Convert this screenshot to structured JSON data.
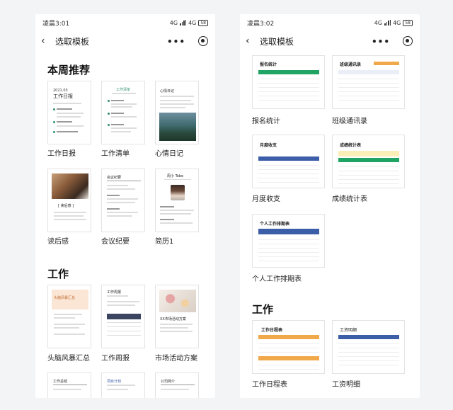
{
  "left_screen": {
    "status": {
      "time": "凌晨3:01",
      "net1": "4G",
      "net2": "4G",
      "battery": "58"
    },
    "nav": {
      "back_glyph": "‹",
      "title": "选取模板",
      "more_glyph": "•••"
    },
    "sections": [
      {
        "title": "本周推荐",
        "templates": [
          {
            "label": "工作日报",
            "thumb_title": "工作日报"
          },
          {
            "label": "工作清单",
            "thumb_title": "工作清单"
          },
          {
            "label": "心情日记",
            "thumb_title": "心情日记"
          },
          {
            "label": "读后感",
            "thumb_title": "[ 读后感 ]"
          },
          {
            "label": "会议纪要",
            "thumb_title": "会议纪要"
          },
          {
            "label": "简历1",
            "thumb_title": "周小 Tobe"
          }
        ]
      },
      {
        "title": "工作",
        "templates": [
          {
            "label": "头脑风暴汇总",
            "thumb_title": "头脑风暴汇总"
          },
          {
            "label": "工作周报",
            "thumb_title": "工作周报"
          },
          {
            "label": "市场活动方案",
            "thumb_title": "XX市场活动方案"
          },
          {
            "label": "",
            "thumb_title": "工作总结"
          },
          {
            "label": "",
            "thumb_title": "项目计划"
          },
          {
            "label": "",
            "thumb_title": "公司简介"
          }
        ]
      }
    ]
  },
  "right_screen": {
    "status": {
      "time": "凌晨3:02",
      "net1": "4G",
      "net2": "4G",
      "battery": "58"
    },
    "nav": {
      "back_glyph": "‹",
      "title": "选取模板",
      "more_glyph": "•••"
    },
    "sections": [
      {
        "title": "",
        "templates": [
          {
            "label": "报名统计",
            "thumb_title": "报名统计"
          },
          {
            "label": "班级通讯录",
            "thumb_title": "班级通讯录"
          },
          {
            "label": "月度收支",
            "thumb_title": "月度收支"
          },
          {
            "label": "成绩统计表",
            "thumb_title": "成绩统计表"
          },
          {
            "label": "个人工作排期表",
            "thumb_title": "个人工作排期表"
          }
        ]
      },
      {
        "title": "工作",
        "templates": [
          {
            "label": "工作日程表",
            "thumb_title": "工作日程表"
          },
          {
            "label": "工资明细",
            "thumb_title": "工资明细"
          }
        ]
      }
    ]
  },
  "colors": {
    "green": "#1fa463",
    "blue": "#3c5da8",
    "orange": "#f0a84a",
    "dark": "#3b4560"
  },
  "icons": [
    "back-chevron-icon",
    "more-dots-icon",
    "target-close-icon",
    "signal-icon",
    "battery-icon"
  ]
}
